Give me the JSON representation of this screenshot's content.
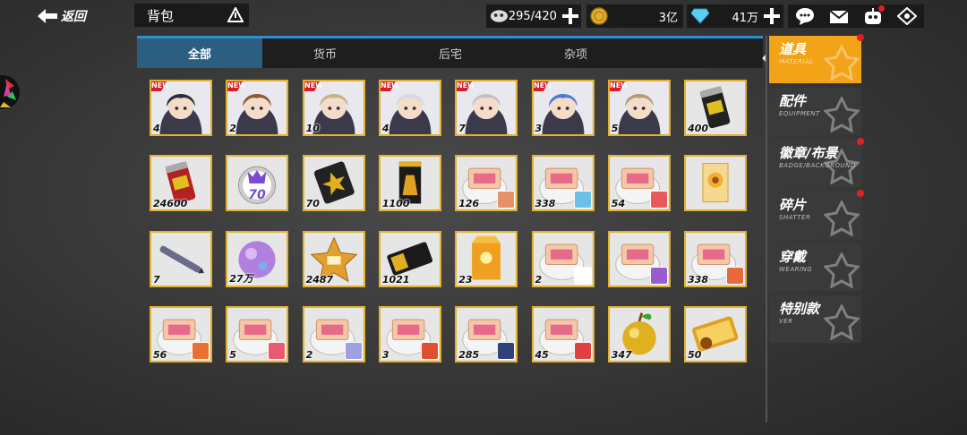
{
  "topbar": {
    "back_label": "返回",
    "title": "背包",
    "stamina": "295/420",
    "gold": "3亿",
    "diamond": "41万"
  },
  "tabs": [
    {
      "label": "全部",
      "active": true
    },
    {
      "label": "货币",
      "active": false
    },
    {
      "label": "后宅",
      "active": false
    },
    {
      "label": "杂项",
      "active": false
    }
  ],
  "items": [
    {
      "count": "4",
      "kind": "char",
      "color": "#2b2b3a",
      "new": true
    },
    {
      "count": "2",
      "kind": "char",
      "color": "#8a5a3a",
      "new": true
    },
    {
      "count": "10",
      "kind": "char",
      "color": "#c9b08a",
      "new": true
    },
    {
      "count": "4",
      "kind": "char",
      "color": "#d8d8e8",
      "new": true
    },
    {
      "count": "7",
      "kind": "char",
      "color": "#c8c0c8",
      "new": true
    },
    {
      "count": "3",
      "kind": "char",
      "color": "#4c7ad0",
      "new": true
    },
    {
      "count": "5",
      "kind": "char",
      "color": "#b89878",
      "new": true
    },
    {
      "count": "400",
      "kind": "can",
      "color": "#222222"
    },
    {
      "count": "24600",
      "kind": "can",
      "color": "#b22222"
    },
    {
      "count": "",
      "kind": "medal",
      "color": "#7a4ad0",
      "label": "70"
    },
    {
      "count": "70",
      "kind": "badge",
      "color": "#222222"
    },
    {
      "count": "1100",
      "kind": "card",
      "color": "#1a1a1a"
    },
    {
      "count": "126",
      "kind": "frag",
      "color": "#e8906a"
    },
    {
      "count": "338",
      "kind": "frag",
      "color": "#6ac0e8"
    },
    {
      "count": "54",
      "kind": "frag",
      "color": "#e85a5a"
    },
    {
      "count": "",
      "kind": "flower",
      "color": "#f0b030"
    },
    {
      "count": "7",
      "kind": "pen",
      "color": "#6a6a8a"
    },
    {
      "count": "27万",
      "kind": "orb",
      "color": "#b080e0"
    },
    {
      "count": "2487",
      "kind": "star",
      "color": "#e0a030"
    },
    {
      "count": "1021",
      "kind": "ticket",
      "color": "#1a1a1a"
    },
    {
      "count": "23",
      "kind": "bag",
      "color": "#f0a020"
    },
    {
      "count": "2",
      "kind": "frag",
      "color": "#ffffff"
    },
    {
      "count": "",
      "kind": "frag",
      "color": "#9a5ad0"
    },
    {
      "count": "338",
      "kind": "frag",
      "color": "#e86a3a"
    },
    {
      "count": "56",
      "kind": "frag",
      "color": "#e87030"
    },
    {
      "count": "5",
      "kind": "frag",
      "color": "#e85a70"
    },
    {
      "count": "2",
      "kind": "frag",
      "color": "#a0a0e0"
    },
    {
      "count": "3",
      "kind": "frag",
      "color": "#e05030"
    },
    {
      "count": "285",
      "kind": "frag",
      "color": "#30407a"
    },
    {
      "count": "45",
      "kind": "frag",
      "color": "#e04040"
    },
    {
      "count": "347",
      "kind": "apple",
      "color": "#e0b020"
    },
    {
      "count": "50",
      "kind": "gold",
      "color": "#e0a020"
    }
  ],
  "sidebar": [
    {
      "label": "道具",
      "sub": "MATERIAL",
      "active": true,
      "dot": true
    },
    {
      "label": "配件",
      "sub": "EQUIPMENT",
      "active": false,
      "dot": false
    },
    {
      "label": "徽章/布景",
      "sub": "BADGE/BACKGROUND",
      "active": false,
      "dot": true
    },
    {
      "label": "碎片",
      "sub": "SHATTER",
      "active": false,
      "dot": true
    },
    {
      "label": "穿戴",
      "sub": "WEARING",
      "active": false,
      "dot": false
    },
    {
      "label": "特别款",
      "sub": "VER",
      "active": false,
      "dot": false
    }
  ]
}
